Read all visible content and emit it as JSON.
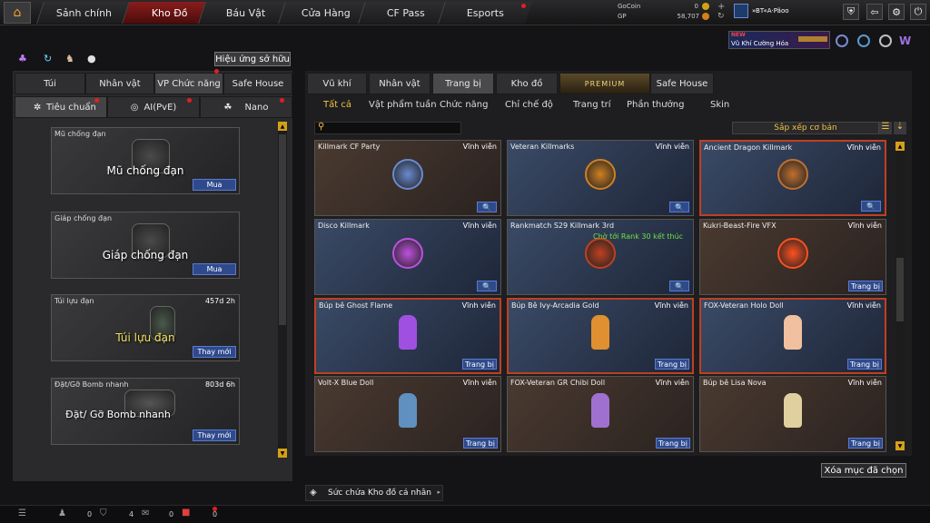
{
  "topnav": {
    "tabs": [
      "Sảnh chính",
      "Kho Đồ",
      "Báu Vật",
      "Cửa Hàng",
      "CF Pass",
      "Esports"
    ]
  },
  "currency": {
    "gocoin_label": "GoCoin",
    "gocoin_value": "0",
    "gp_label": "GP",
    "gp_value": "58,707",
    "player_name": "»BT«A·Pãoo"
  },
  "promo": {
    "badge": "NEW",
    "text": "Vũ Khí Cường Hóa"
  },
  "left": {
    "effect_button": "Hiệu ứng sở hữu",
    "tabs": [
      "Túi",
      "Nhân vật",
      "VP Chức năng",
      "Safe House"
    ],
    "subtabs": [
      "Tiêu chuẩn",
      "AI(PvE)",
      "Nano"
    ],
    "items": [
      {
        "name": "Mũ chống đạn",
        "big": "Mũ chống đạn",
        "duration": "",
        "action": "Mua"
      },
      {
        "name": "Giáp chống đạn",
        "big": "Giáp chống đạn",
        "duration": "",
        "action": "Mua"
      },
      {
        "name": "Túi lựu đạn",
        "big": "Túi lựu đạn",
        "duration": "457d 2h",
        "action": "Thay mới"
      },
      {
        "name": "Đặt/Gỡ Bomb nhanh",
        "big": "Đặt/ Gỡ Bomb nhanh",
        "duration": "803d 6h",
        "action": "Thay mới"
      }
    ]
  },
  "right": {
    "tabs": [
      "Vũ khí",
      "Nhân vật",
      "Trang bị",
      "Kho đồ",
      "PREMIUM",
      "Safe House"
    ],
    "subtabs": [
      "Tất cả",
      "Vật phẩm tuần",
      "Chức năng",
      "Chỉ chế độ",
      "Trang trí",
      "Phần thưởng",
      "Skin"
    ],
    "sort_label": "Sắp xếp cơ bản",
    "cards": [
      {
        "name": "Killmark CF Party",
        "duration": "Vĩnh viễn",
        "action": "🔍",
        "style": "brown",
        "color": "#6a8ad0"
      },
      {
        "name": "Veteran Killmarks",
        "duration": "Vĩnh viễn",
        "action": "🔍",
        "style": "blue",
        "color": "#d08020"
      },
      {
        "name": "Ancient Dragon Killmark",
        "duration": "Vĩnh viễn",
        "action": "🔍",
        "style": "red",
        "color": "#c07030"
      },
      {
        "name": "Disco Killmark",
        "duration": "Vĩnh viễn",
        "action": "🔍",
        "style": "blue",
        "color": "#c050e0"
      },
      {
        "name": "Rankmatch S29 Killmark 3rd",
        "duration": "",
        "action": "🔍",
        "style": "blue",
        "color": "#c04020",
        "note": "Chờ tới Rank 30 kết thúc"
      },
      {
        "name": "Kukri-Beast-Fire VFX",
        "duration": "Vĩnh viễn",
        "action": "Trang bị",
        "style": "brown",
        "color": "#ff5020"
      },
      {
        "name": "Búp bê Ghost Flame",
        "duration": "Vĩnh viễn",
        "action": "Trang bị",
        "style": "red",
        "color": "#a050e0"
      },
      {
        "name": "Búp Bê Ivy-Arcadia Gold",
        "duration": "Vĩnh viễn",
        "action": "Trang bị",
        "style": "red",
        "color": "#e09030"
      },
      {
        "name": "FOX-Veteran Holo Doll",
        "duration": "Vĩnh viễn",
        "action": "Trang bị",
        "style": "red",
        "color": "#f0c0a0"
      },
      {
        "name": "Volt-X Blue Doll",
        "duration": "Vĩnh viễn",
        "action": "Trang bị",
        "style": "brown",
        "color": "#6090c0"
      },
      {
        "name": "FOX-Veteran GR Chibi Doll",
        "duration": "Vĩnh viễn",
        "action": "Trang bị",
        "style": "brown",
        "color": "#a070d0"
      },
      {
        "name": "Búp bê Lisa Nova",
        "duration": "Vĩnh viễn",
        "action": "Trang bị",
        "style": "brown",
        "color": "#e0d0a0"
      }
    ],
    "clear_button": "Xóa mục đã chọn",
    "capacity_label": "Sức chứa Kho đồ cá nhân"
  },
  "bottom": {
    "v1": "0",
    "v2": "0",
    "v3": "4",
    "v4": "0",
    "v5": "0"
  }
}
